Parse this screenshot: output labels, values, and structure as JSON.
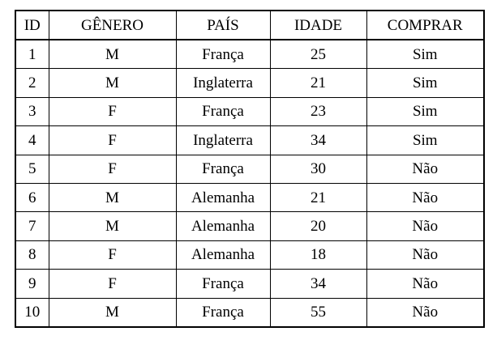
{
  "table": {
    "headers": [
      "ID",
      "GÊNERO",
      "PAÍS",
      "IDADE",
      "COMPRAR"
    ],
    "rows": [
      [
        "1",
        "M",
        "França",
        "25",
        "Sim"
      ],
      [
        "2",
        "M",
        "Inglaterra",
        "21",
        "Sim"
      ],
      [
        "3",
        "F",
        "França",
        "23",
        "Sim"
      ],
      [
        "4",
        "F",
        "Inglaterra",
        "34",
        "Sim"
      ],
      [
        "5",
        "F",
        "França",
        "30",
        "Não"
      ],
      [
        "6",
        "M",
        "Alemanha",
        "21",
        "Não"
      ],
      [
        "7",
        "M",
        "Alemanha",
        "20",
        "Não"
      ],
      [
        "8",
        "F",
        "Alemanha",
        "18",
        "Não"
      ],
      [
        "9",
        "F",
        "França",
        "34",
        "Não"
      ],
      [
        "10",
        "M",
        "França",
        "55",
        "Não"
      ]
    ]
  }
}
